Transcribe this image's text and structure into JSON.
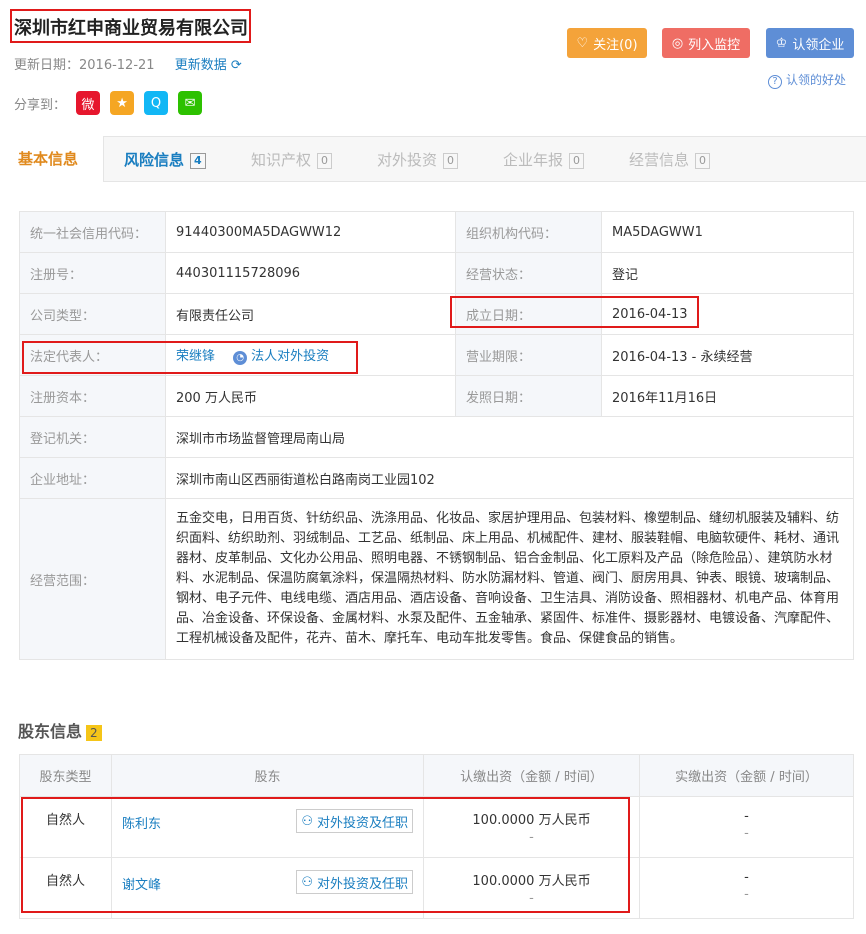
{
  "company": {
    "name": "深圳市红申商业贸易有限公司"
  },
  "meta": {
    "update_label": "更新日期：2016-12-21",
    "refresh_label": "更新数据"
  },
  "share": {
    "label": "分享到："
  },
  "actions": {
    "follow_label": "关注(0)",
    "monitor_label": "列入监控",
    "claim_label": "认领企业",
    "benefit_label": "认领的好处"
  },
  "tabs": [
    {
      "label": "基本信息",
      "count": ""
    },
    {
      "label": "风险信息",
      "count": "4"
    },
    {
      "label": "知识产权",
      "count": "0"
    },
    {
      "label": "对外投资",
      "count": "0"
    },
    {
      "label": "企业年报",
      "count": "0"
    },
    {
      "label": "经营信息",
      "count": "0"
    }
  ],
  "basic": {
    "credit_code_label": "统一社会信用代码：",
    "credit_code": "91440300MA5DAGWW12",
    "org_code_label": "组织机构代码：",
    "org_code": "MA5DAGWW1",
    "reg_no_label": "注册号：",
    "reg_no": "440301115728096",
    "status_label": "经营状态：",
    "status": "登记",
    "type_label": "公司类型：",
    "type": "有限责任公司",
    "est_label": "成立日期：",
    "est_date": "2016-04-13",
    "legal_label": "法定代表人：",
    "legal_name": "荣继锋",
    "legal_invest": "法人对外投资",
    "term_label": "营业期限：",
    "term": "2016-04-13 - 永续经营",
    "capital_label": "注册资本：",
    "capital": "200 万人民币",
    "issue_label": "发照日期：",
    "issue_date": "2016年11月16日",
    "authority_label": "登记机关：",
    "authority": "深圳市市场监督管理局南山局",
    "address_label": "企业地址：",
    "address": "深圳市南山区西丽街道松白路南岗工业园102",
    "scope_label": "经营范围：",
    "scope": "五金交电，日用百货、针纺织品、洗涤用品、化妆品、家居护理用品、包装材料、橡塑制品、缝纫机服装及辅料、纺织面料、纺织助剂、羽绒制品、工艺品、纸制品、床上用品、机械配件、建材、服装鞋帽、电脑软硬件、耗材、通讯器材、皮革制品、文化办公用品、照明电器、不锈钢制品、铝合金制品、化工原料及产品（除危险品）、建筑防水材料、水泥制品、保温防腐氧涂料，保温隔热材料、防水防漏材料、管道、阀门、厨房用具、钟表、眼镜、玻璃制品、钢材、电子元件、电线电缆、酒店用品、酒店设备、音响设备、卫生洁具、消防设备、照相器材、机电产品、体育用品、冶金设备、环保设备、金属材料、水泵及配件、五金轴承、紧固件、标准件、摄影器材、电镀设备、汽摩配件、工程机械设备及配件，花卉、苗木、摩托车、电动车批发零售。食品、保健食品的销售。"
  },
  "shareholders": {
    "title": "股东信息",
    "count": "2",
    "headers": [
      "股东类型",
      "股东",
      "认缴出资（金额 / 时间）",
      "实缴出资（金额 / 时间）"
    ],
    "invest_label": "对外投资及任职",
    "rows": [
      {
        "type": "自然人",
        "name": "陈利东",
        "subscribed": "100.0000 万人民币",
        "subscribed_time": "-",
        "paid": "-",
        "paid_time": "-"
      },
      {
        "type": "自然人",
        "name": "谢文峰",
        "subscribed": "100.0000 万人民币",
        "subscribed_time": "-",
        "paid": "-",
        "paid_time": "-"
      }
    ]
  },
  "colors": {
    "accent_orange": "#f4a33a",
    "accent_red": "#ef6d64",
    "accent_blue": "#5e8ed6",
    "link": "#1a7ec0",
    "highlight_box": "#e01a1a"
  }
}
